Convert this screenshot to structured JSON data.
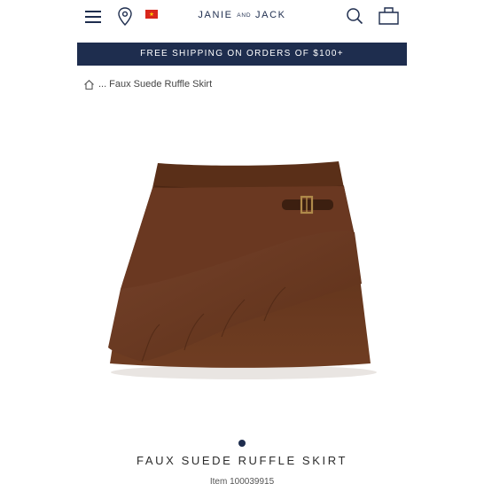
{
  "header": {
    "brand_main_1": "JANIE",
    "brand_small": "AND",
    "brand_main_2": "JACK",
    "icons": [
      "menu-icon",
      "location-icon",
      "flag-icon",
      "search-icon",
      "bag-icon"
    ]
  },
  "promo": {
    "text": "FREE SHIPPING ON ORDERS OF $100+"
  },
  "breadcrumb": {
    "ellipsis": "...",
    "current": "Faux Suede Ruffle Skirt"
  },
  "product": {
    "title": "FAUX SUEDE RUFFLE SKIRT",
    "item_number": "Item 100039915",
    "image_dots": 1
  },
  "colors": {
    "navy": "#1e2d4e",
    "skirt_brown": "#6b3b22"
  }
}
